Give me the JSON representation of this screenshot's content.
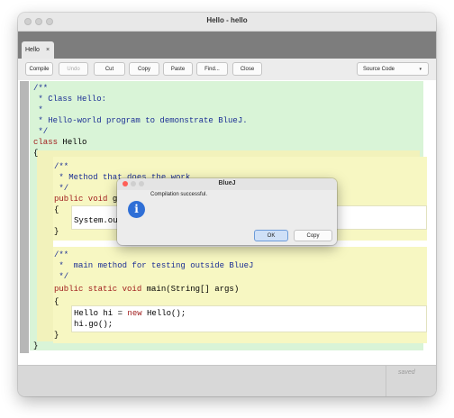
{
  "window": {
    "title": "Hello - hello"
  },
  "tabs": [
    {
      "label": "Hello",
      "close": "×"
    }
  ],
  "toolbar": {
    "compile": "Compile",
    "undo": "Undo",
    "cut": "Cut",
    "copy": "Copy",
    "paste": "Paste",
    "find": "Find...",
    "close": "Close",
    "view_selected": "Source Code",
    "view_arrow": "▾"
  },
  "code": {
    "l1": "/**",
    "l2": " * Class Hello:",
    "l3": " *",
    "l4": " * Hello-world program to demonstrate BlueJ.",
    "l5": " */",
    "l6_kw": "class",
    "l6_rest": " Hello",
    "l7": "{",
    "m1_c1": "/**",
    "m1_c2": " * Method that does the work",
    "m1_c3": " */",
    "m1_sig_kw": "public void",
    "m1_sig_rest": " g",
    "m1_open": "{",
    "m1_body": "System.ou",
    "m1_close": "}",
    "m2_c1": "/**",
    "m2_c2": " *  main method for testing outside BlueJ",
    "m2_c3": " */",
    "m2_sig_kw1": "public static void",
    "m2_sig_rest": " main(String[] args)",
    "m2_open": "{",
    "m2_b1_a": "Hello hi = ",
    "m2_b1_kw": "new",
    "m2_b1_b": " Hello();",
    "m2_b2": "hi.go();",
    "m2_close": "}",
    "class_close": "}"
  },
  "status": {
    "text": "saved"
  },
  "dialog": {
    "title": "BlueJ",
    "message": "Compilation successful.",
    "icon": "i",
    "ok": "OK",
    "copy": "Copy"
  },
  "colors": {
    "class_bg": "#d9f4d7",
    "method_bg": "#f7f7c2",
    "keyword": "#a01c1c",
    "comment": "#1b2e94",
    "info_icon": "#2f6fd6",
    "close_light": "#ff5f57"
  }
}
